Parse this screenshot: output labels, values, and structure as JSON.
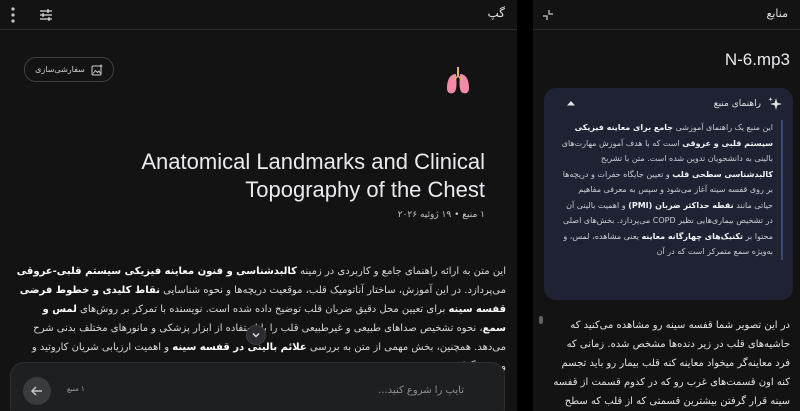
{
  "chat": {
    "header_title": "گپ",
    "customize_label": "سفارشی‌سازی",
    "note": {
      "title": "Anatomical Landmarks and Clinical Topography of the Chest",
      "meta": "۱ منبع • ۱۹ ژوئیه ۲۰۲۶",
      "body_segments": [
        {
          "t": "این متن به ارائه راهنمای جامع و کاربردی در زمینه ",
          "b": false
        },
        {
          "t": "کالبدشناسی و فنون معاینه فیزیکی سیستم قلبی-عروقی",
          "b": true
        },
        {
          "t": " می‌پردازد. در این آموزش، ساختار آناتومیک قلب، موقعیت دریچه‌ها و نحوه شناسایی ",
          "b": false
        },
        {
          "t": "نقاط کلیدی و خطوط فرضی قفسه سینه",
          "b": true
        },
        {
          "t": " برای تعیین محل دقیق ضربان قلب توضیح داده شده است. نویسنده با تمرکز بر روش‌های ",
          "b": false
        },
        {
          "t": "لمس و سمع",
          "b": true
        },
        {
          "t": "، نحوه تشخیص صداهای طبیعی و غیرطبیعی قلب را با استفاده از ابزار پزشکی و مانورهای مختلف بدنی شرح می‌دهد. همچنین، بخش مهمی از متن به بررسی ",
          "b": false
        },
        {
          "t": "علائم بالینی در قفسه سینه",
          "b": true
        },
        {
          "t": " و اهمیت ارزیابی شریان کاروتید و ورید ژوگولار",
          "b": false
        }
      ]
    },
    "composer": {
      "placeholder": "تایپ را شروع کنید...",
      "source_count": "۱ منبع"
    }
  },
  "source": {
    "header_title": "منابع",
    "file_name": "N-6.mp3",
    "guide": {
      "title": "راهنمای منبع",
      "segments": [
        {
          "t": "این منبع یک راهنمای آموزشی ",
          "b": false
        },
        {
          "t": "جامع برای معاینه فیزیکی سیستم قلبی و عروقی",
          "b": true
        },
        {
          "t": " است که با هدف آموزش مهارت‌های بالینی به دانشجویان تدوین شده است. متن با تشریح ",
          "b": false
        },
        {
          "t": "کالبدشناسی سطحی قلب",
          "b": true
        },
        {
          "t": " و تعیین جایگاه حفرات و دریچه‌ها بر روی قفسه سینه آغاز می‌شود و سپس به معرفی مفاهیم حیاتی مانند ",
          "b": false
        },
        {
          "t": "نقطه حداکثر ضربان (PMI)",
          "b": true
        },
        {
          "t": " و اهمیت بالینی آن در تشخیص بیماری‌هایی نظیر COPD می‌پردازد. بخش‌های اصلی محتوا بر ",
          "b": false
        },
        {
          "t": "تکنیک‌های چهارگانه معاینه",
          "b": true
        },
        {
          "t": " یعنی مشاهده، لمس، و به‌ویژه سمع متمرکز است که در آن",
          "b": false
        }
      ]
    },
    "transcript": "در این تصویر شما قفسه سینه رو مشاهده می‌کنید که حاشیه‌های قلب در زیر دنده‌ها مشخص شده. زمانی که فرد معاینه‌گر میخواد معاینه کنه قلب بیمار رو باید تجسم کنه اون قسمت‌های غرب رو که در کدوم قسمت از قفسه سینه قرار گرفتن بیشترین قسمتی که از قلب که سطح"
  },
  "colors": {
    "panel_bg": "#131314",
    "app_bg": "#000000",
    "guide_bg": "#1e2233",
    "composer_bg": "#1e1f20"
  }
}
